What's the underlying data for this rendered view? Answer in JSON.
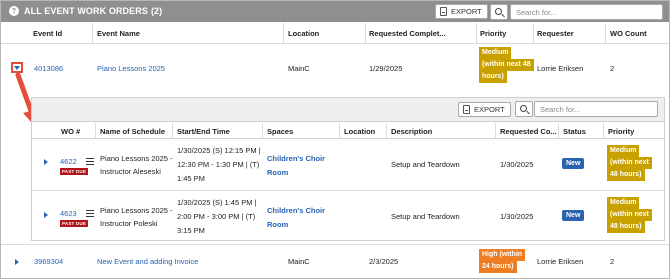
{
  "header": {
    "title": "ALL EVENT WORK ORDERS",
    "count": "(2)",
    "export_label": "EXPORT",
    "search_placeholder": "Search for..."
  },
  "columns": [
    "Event Id",
    "Event Name",
    "Location",
    "Requested Complet...",
    "Priority",
    "Requester",
    "WO Count"
  ],
  "events": [
    {
      "event_id": "4013086",
      "event_name": "Piano Lessons 2025",
      "location": "MainC",
      "requested": "1/29/2025",
      "priority_lines": [
        "Medium",
        "(within next 48",
        "hours)"
      ],
      "requester": "Lorrie Eriksen",
      "wo_count": "2"
    },
    {
      "event_id": "3969304",
      "event_name": "New Event and adding Invoice",
      "location": "MainC",
      "requested": "2/3/2025",
      "priority_lines": [
        "High (within",
        "24 hours)"
      ],
      "requester": "Lorrie Eriksen",
      "wo_count": "2"
    }
  ],
  "inner": {
    "export_label": "EXPORT",
    "search_placeholder": "Search for...",
    "columns": [
      "WO #",
      "Name of Schedule",
      "Start/End Time",
      "Spaces",
      "Location",
      "Description",
      "Requested Co...",
      "Status",
      "Priority"
    ],
    "rows": [
      {
        "wo": "4622",
        "past_due": "PAST DUE",
        "schedule_lines": [
          "Piano Lessons 2025 -",
          "Instructor Aleseski"
        ],
        "time_lines": [
          "1/30/2025 (S) 12:15 PM |",
          "12:30 PM - 1:30 PM | (T)",
          "1:45 PM"
        ],
        "space_lines": [
          "Children's Choir",
          "Room"
        ],
        "location": "",
        "description": "Setup and Teardown",
        "requested": "1/30/2025",
        "status": "New",
        "priority_lines": [
          "Medium",
          "(within next",
          "48 hours)"
        ]
      },
      {
        "wo": "4623",
        "past_due": "PAST DUE",
        "schedule_lines": [
          "Piano Lessons 2025 -",
          "Instructor Poleski"
        ],
        "time_lines": [
          "1/30/2025 (S) 1:45 PM |",
          "2:00 PM - 3:00 PM | (T)",
          "3:15 PM"
        ],
        "space_lines": [
          "Children's Choir",
          "Room"
        ],
        "location": "",
        "description": "Setup and Teardown",
        "requested": "1/30/2025",
        "status": "New",
        "priority_lines": [
          "Medium",
          "(within next",
          "48 hours)"
        ]
      }
    ]
  },
  "colors": {
    "header_bg": "#8f8f8f",
    "link": "#2a63b1",
    "medium": "#c8a000",
    "high": "#ef7d22",
    "past_due": "#b0151b",
    "arrow": "#e44d3b"
  }
}
